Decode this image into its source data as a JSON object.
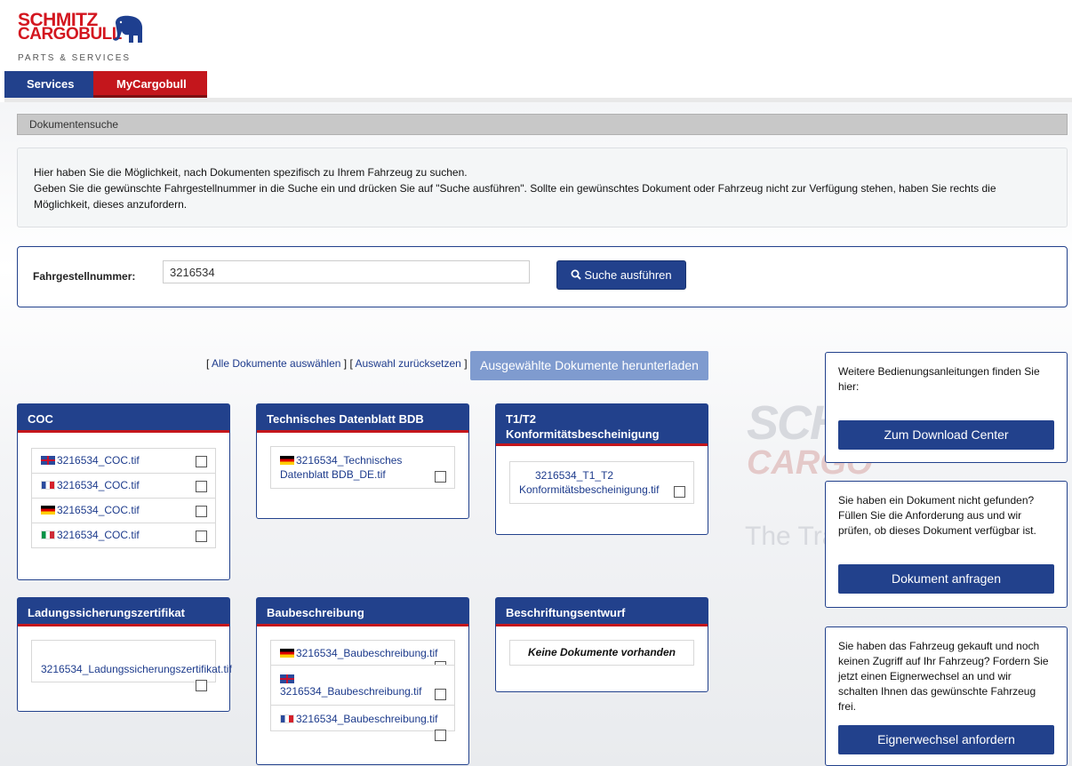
{
  "brand": {
    "name_line1": "SCHMITZ",
    "name_line2": "CARGOBULL",
    "subline": "PARTS & SERVICES"
  },
  "nav": {
    "items": [
      {
        "label": "Services",
        "active": false
      },
      {
        "label": "MyCargobull",
        "active": true
      }
    ]
  },
  "panel": {
    "title": "Dokumentensuche",
    "info_line1": "Hier haben Sie die Möglichkeit, nach Dokumenten spezifisch zu Ihrem Fahrzeug zu suchen.",
    "info_line2": "Geben Sie die gewünschte Fahrgestellnummer in die Suche ein und drücken Sie auf \"Suche ausführen\". Sollte ein gewünschtes Dokument oder Fahrzeug nicht zur Verfügung stehen, haben Sie rechts die Möglichkeit, dieses anzufordern."
  },
  "search": {
    "label": "Fahrgestellnummer:",
    "value": "3216534",
    "button": "Suche ausführen"
  },
  "selection": {
    "open_bracket": "[",
    "select_all": "Alle Dokumente auswählen",
    "separator": "] [",
    "reset": "Auswahl zurücksetzen",
    "close_bracket": "]",
    "download_button": "Ausgewählte Dokumente herunterladen"
  },
  "cards": {
    "coc": {
      "title": "COC",
      "items": [
        {
          "flag": "uk",
          "name": "3216534_COC.tif"
        },
        {
          "flag": "fr",
          "name": "3216534_COC.tif"
        },
        {
          "flag": "de",
          "name": "3216534_COC.tif"
        },
        {
          "flag": "it",
          "name": "3216534_COC.tif"
        }
      ]
    },
    "bdb": {
      "title": "Technisches Datenblatt BDB",
      "items": [
        {
          "flag": "de",
          "name_line1": "3216534_Technisches",
          "name_line2": "Datenblatt BDB_DE.tif"
        }
      ]
    },
    "t1t2": {
      "title_line1": "T1/T2",
      "title_line2": "Konformitätsbescheinigung",
      "items": [
        {
          "flag": "",
          "name_line1": "3216534_T1_T2",
          "name_line2": "Konformitätsbescheinigung.tif"
        }
      ]
    },
    "lsz": {
      "title": "Ladungssicherungszertifikat",
      "items": [
        {
          "flag": "",
          "name": "3216534_Ladungssicherungszertifikat.tif"
        }
      ]
    },
    "bau": {
      "title": "Baubeschreibung",
      "items": [
        {
          "flag": "de",
          "name": "3216534_Baubeschreibung.tif"
        },
        {
          "flag": "uk",
          "name": "3216534_Baubeschreibung.tif"
        },
        {
          "flag": "fr",
          "name": "3216534_Baubeschreibung.tif"
        }
      ]
    },
    "besch": {
      "title": "Beschriftungsentwurf",
      "empty": "Keine Dokumente vorhanden"
    }
  },
  "sidebar": {
    "download": {
      "text": "Weitere Bedienungsanleitungen finden Sie hier:",
      "button": "Zum Download Center"
    },
    "request": {
      "text": "Sie haben ein Dokument nicht gefunden? Füllen Sie die Anforderung aus und wir prüfen, ob dieses Dokument verfügbar ist.",
      "button": "Dokument anfragen"
    },
    "owner": {
      "text": "Sie haben das Fahrzeug gekauft und noch keinen Zugriff auf Ihr Fahrzeug? Fordern Sie jetzt einen Eignerwechsel an und wir schalten Ihnen das gewünschte Fahrzeug frei.",
      "button": "Eignerwechsel anfordern"
    }
  },
  "background": {
    "watermark_line1": "SCHI",
    "watermark_line2": "CARGO",
    "watermark_line3": "The Tra"
  },
  "colors": {
    "brand_blue": "#22418c",
    "brand_red": "#c4161c",
    "disabled_button": "#7f9bcf"
  }
}
